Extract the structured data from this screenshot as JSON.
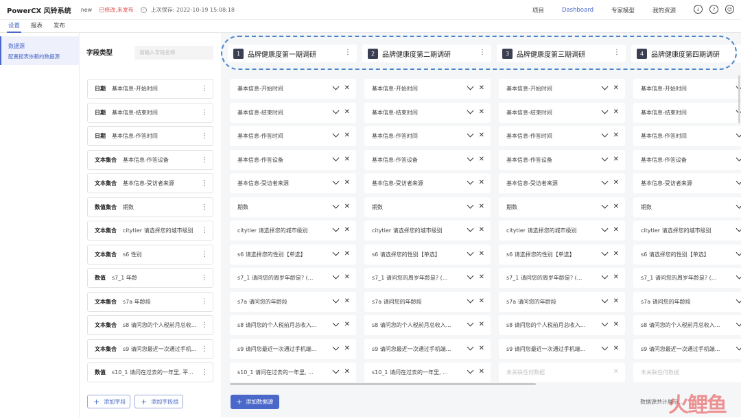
{
  "header": {
    "brand": "PowerCX 风铃系统",
    "version": "new",
    "status": "已修改,未发布",
    "saved": "上次保存: 2022-10-19 15:08:18",
    "nav": [
      "项目",
      "Dashboard",
      "专家模型",
      "我的资源"
    ],
    "active_nav": "Dashboard"
  },
  "tabs": [
    "设置",
    "报表",
    "发布"
  ],
  "sidebar": {
    "title": "数据源",
    "subtitle": "配置报表依赖的数据源"
  },
  "field_panel": {
    "header": "字段类型",
    "search_placeholder": "请输入字段名称",
    "add_field": "添加字段",
    "add_group": "添加字段组"
  },
  "fields": [
    {
      "type": "日期",
      "name": "基本信息-开始时间"
    },
    {
      "type": "日期",
      "name": "基本信息-结束时间"
    },
    {
      "type": "日期",
      "name": "基本信息-作答时间"
    },
    {
      "type": "文本集合",
      "name": "基本信息-作答设备"
    },
    {
      "type": "文本集合",
      "name": "基本信息-受访者来源"
    },
    {
      "type": "数值集合",
      "name": "期数"
    },
    {
      "type": "文本集合",
      "name": "citytier 请选择您的城市级别"
    },
    {
      "type": "文本集合",
      "name": "s6 性别"
    },
    {
      "type": "数值",
      "name": "s7_1 年龄"
    },
    {
      "type": "文本集合",
      "name": "s7a 年龄段"
    },
    {
      "type": "文本集合",
      "name": "s8 请问您的个人税前月总收..."
    },
    {
      "type": "文本集合",
      "name": "s9 请问您最近一次通过手机..."
    },
    {
      "type": "数值",
      "name": "s10_1 请问在过去的一年里, 平..."
    }
  ],
  "datasources": [
    {
      "num": "1",
      "title": "品牌健康度第一期调研"
    },
    {
      "num": "2",
      "title": "品牌健康度第二期调研"
    },
    {
      "num": "3",
      "title": "品牌健康度第三期调研"
    },
    {
      "num": "4",
      "title": "品牌健康度第四期调研"
    }
  ],
  "mappings": [
    [
      "基本信息-开始时间",
      "基本信息-开始时间",
      "基本信息-开始时间",
      "基本信息-开始时间"
    ],
    [
      "基本信息-结束时间",
      "基本信息-结束时间",
      "基本信息-结束时间",
      "基本信息-结束时间"
    ],
    [
      "基本信息-作答时间",
      "基本信息-作答时间",
      "基本信息-作答时间",
      "基本信息-作答时间"
    ],
    [
      "基本信息-作答设备",
      "基本信息-作答设备",
      "基本信息-作答设备",
      "基本信息-作答设备"
    ],
    [
      "基本信息-受访者来源",
      "基本信息-受访者来源",
      "基本信息-受访者来源",
      "基本信息-受访者来源"
    ],
    [
      "期数",
      "期数",
      "期数",
      "期数"
    ],
    [
      "citytier 请选择您的城市级别",
      "citytier 请选择您的城市级别",
      "citytier 请选择您的城市级别",
      "citytier 请选择您的城市级别"
    ],
    [
      "s6 请选择您的性别【单选】",
      "s6 请选择您的性别【单选】",
      "s6 请选择您的性别【单选】",
      "s6 请选择您的性别【单选】"
    ],
    [
      "s7_1 请问您的周岁年龄是? (...",
      "s7_1 请问您的周岁年龄是? (...",
      "s7_1 请问您的周岁年龄是? (...",
      "s7_1 请问您的周岁年龄是? (..."
    ],
    [
      "s7a 请问您的年龄段",
      "s7a 请问您的年龄段",
      "s7a 请问您的年龄段",
      "s7a 请问您的年龄段"
    ],
    [
      "s8 请问您的个人税前月总收入...",
      "s8 请问您的个人税前月总收入...",
      "s8 请问您的个人税前月总收入...",
      "s8 请问您的个人税前月总收入..."
    ],
    [
      "s9 请问您最近一次通过手机端...",
      "s9 请问您最近一次通过手机端...",
      "s9 请问您最近一次通过手机端...",
      "s9 请问您最近一次通过手机端..."
    ],
    [
      "s10_1 请问在过去的一年里, ...",
      "s10_1 请问在过去的一年里, ...",
      "未关联任何数据",
      "未关联任何数据"
    ]
  ],
  "unmapped_text": "未关联任何数据",
  "add_datasource": "添加数据源",
  "footer_text": "数据源共计展示...",
  "watermark": "火鲤鱼",
  "icons": [
    "download-icon",
    "help-icon",
    "user-icon"
  ]
}
